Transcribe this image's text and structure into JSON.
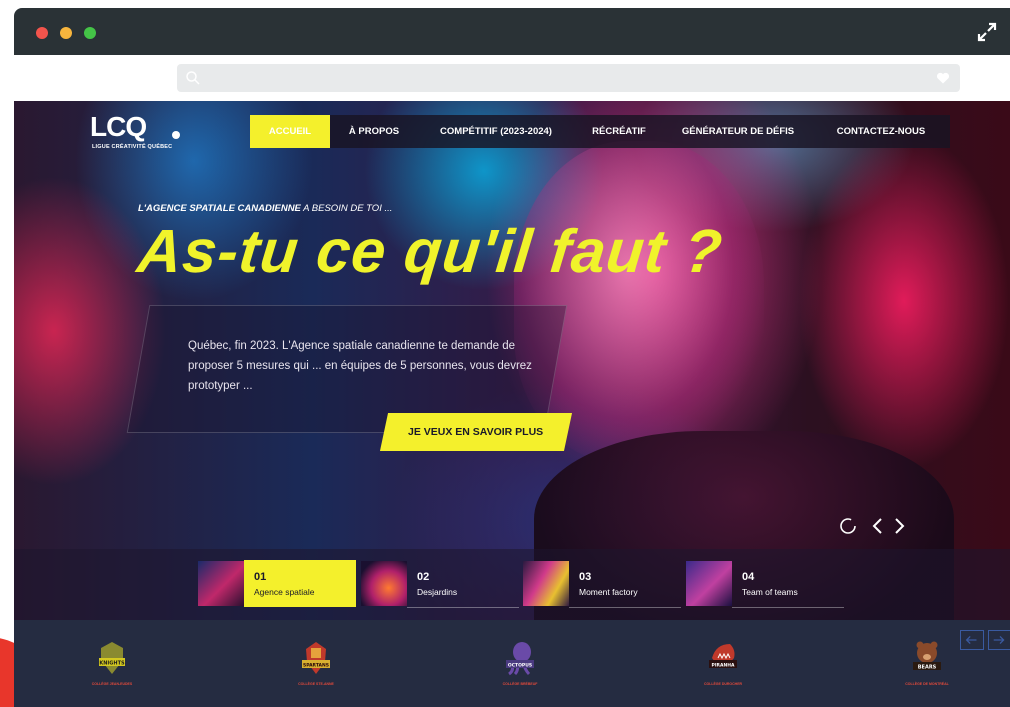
{
  "window": {
    "controls": [
      "close",
      "minimize",
      "zoom"
    ],
    "expand_icon": "expand-arrows-icon"
  },
  "addressbar": {
    "search_icon": "search-icon",
    "value": "",
    "favorite_icon": "heart-icon"
  },
  "site": {
    "logo_text": "LCQ",
    "logo_sub": "LIGUE CRÉATIVITÉ QUÉBEC",
    "nav": [
      {
        "label": "ACCUEIL",
        "active": true
      },
      {
        "label": "À PROPOS",
        "active": false
      },
      {
        "label": "COMPÉTITIF (2023-2024)",
        "active": false
      },
      {
        "label": "RÉCRÉATIF",
        "active": false
      },
      {
        "label": "GÉNÉRATEUR DE DÉFIS",
        "active": false
      },
      {
        "label": "CONTACTEZ-NOUS",
        "active": false
      }
    ]
  },
  "hero": {
    "kicker_bold": "L'AGENCE SPATIALE CANADIENNE",
    "kicker_rest": " A BESOIN DE TOI ...",
    "headline": "As-tu ce qu'il faut ?",
    "body": "Québec, fin 2023. L'Agence spatiale canadienne te demande de proposer 5 mesures qui ... en équipes de 5 personnes, vous devrez prototyper ...",
    "cta": "JE VEUX EN SAVOIR PLUS",
    "accent_color": "#f4f02c"
  },
  "slides": [
    {
      "num": "01",
      "name": "Agence spatiale",
      "active": true
    },
    {
      "num": "02",
      "name": "Desjardins",
      "active": false
    },
    {
      "num": "03",
      "name": "Moment factory",
      "active": false
    },
    {
      "num": "04",
      "name": "Team of teams",
      "active": false
    }
  ],
  "teams": [
    {
      "crest": "KNIGHTS",
      "school": "COLLÈGE JEAN-EUDES"
    },
    {
      "crest": "SPARTANS",
      "school": "COLLÈGE STE-ANNE"
    },
    {
      "crest": "OCTOPUS",
      "school": "COLLÈGE BRÉBEUF"
    },
    {
      "crest": "PIRANHA",
      "school": "COLLÈGE DUROCHER"
    },
    {
      "crest": "BEARS",
      "school": "COLLÈGE DE MONTRÉAL"
    }
  ],
  "team_nav": {
    "prev": "←",
    "next": "→"
  }
}
